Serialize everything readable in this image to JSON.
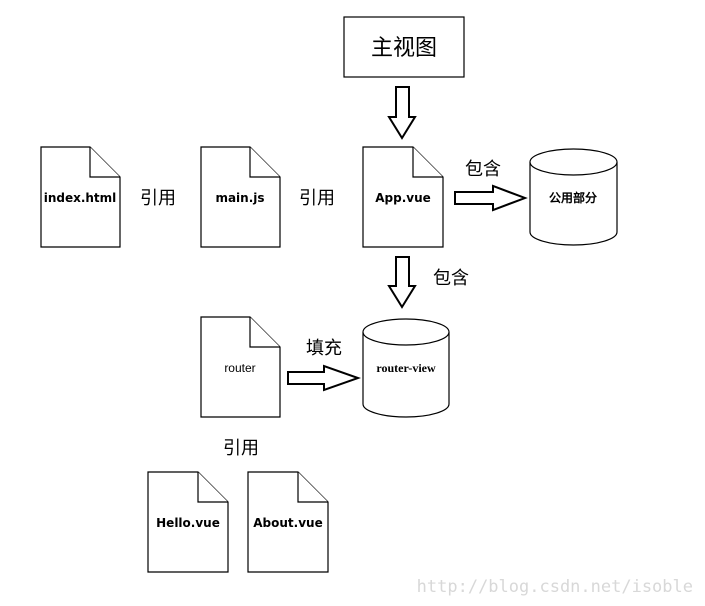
{
  "diagram": {
    "main_view": {
      "label": "主视图"
    },
    "files": {
      "index_html": {
        "label": "index.html"
      },
      "main_js": {
        "label": "main.js"
      },
      "app_vue": {
        "label": "App.vue"
      },
      "router": {
        "label": "router"
      },
      "hello_vue": {
        "label": "Hello.vue"
      },
      "about_vue": {
        "label": "About.vue"
      }
    },
    "storages": {
      "common_part": {
        "label": "公用部分"
      },
      "router_view": {
        "label": "router-view"
      }
    },
    "edge_labels": {
      "index_to_main": "引用",
      "main_to_app": "引用",
      "app_to_common": "包含",
      "app_to_router_view": "包含",
      "router_to_router_view": "填充",
      "router_to_components": "引用"
    },
    "edges": [
      {
        "from": "main_view",
        "to": "app_vue",
        "label": ""
      },
      {
        "from": "index_html",
        "to": "main_js",
        "label": "引用"
      },
      {
        "from": "main_js",
        "to": "app_vue",
        "label": "引用"
      },
      {
        "from": "app_vue",
        "to": "common_part",
        "label": "包含"
      },
      {
        "from": "app_vue",
        "to": "router_view",
        "label": "包含"
      },
      {
        "from": "router",
        "to": "router_view",
        "label": "填充"
      },
      {
        "from": "router",
        "to": "hello_vue",
        "label": "引用"
      },
      {
        "from": "router",
        "to": "about_vue",
        "label": "引用"
      }
    ]
  },
  "watermark": "http://blog.csdn.net/isoble"
}
